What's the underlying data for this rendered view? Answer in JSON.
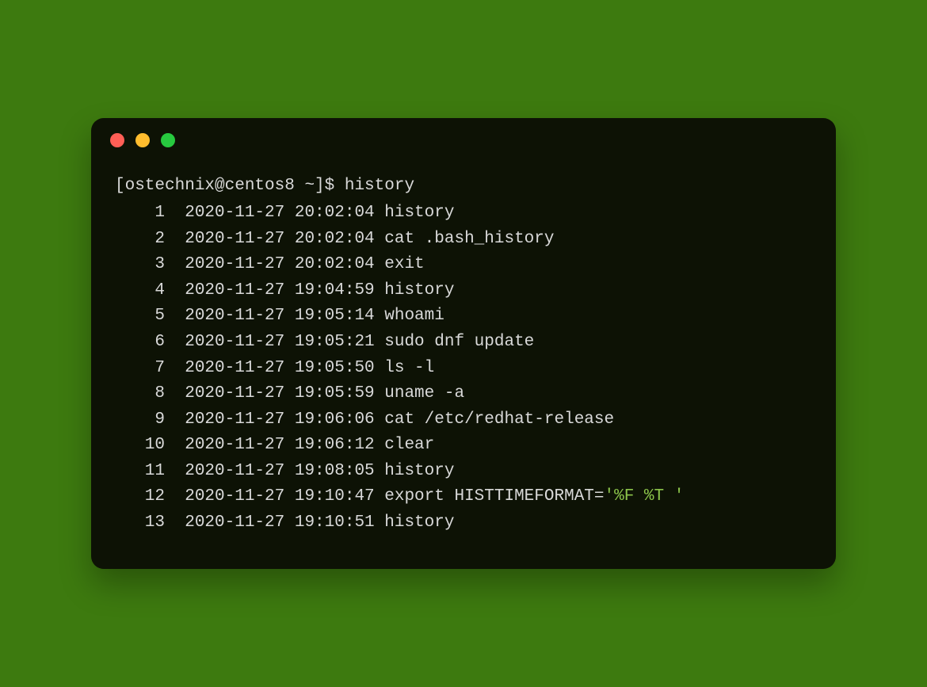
{
  "prompt": {
    "user": "ostechnix",
    "host": "centos8",
    "path": "~",
    "symbol": "$",
    "command": "history"
  },
  "history": [
    {
      "n": 1,
      "ts": "2020-11-27 20:02:04",
      "cmd": "history"
    },
    {
      "n": 2,
      "ts": "2020-11-27 20:02:04",
      "cmd": "cat .bash_history"
    },
    {
      "n": 3,
      "ts": "2020-11-27 20:02:04",
      "cmd": "exit"
    },
    {
      "n": 4,
      "ts": "2020-11-27 19:04:59",
      "cmd": "history"
    },
    {
      "n": 5,
      "ts": "2020-11-27 19:05:14",
      "cmd": "whoami"
    },
    {
      "n": 6,
      "ts": "2020-11-27 19:05:21",
      "cmd": "sudo dnf update"
    },
    {
      "n": 7,
      "ts": "2020-11-27 19:05:50",
      "cmd": "ls -l"
    },
    {
      "n": 8,
      "ts": "2020-11-27 19:05:59",
      "cmd": "uname -a"
    },
    {
      "n": 9,
      "ts": "2020-11-27 19:06:06",
      "cmd": "cat /etc/redhat-release"
    },
    {
      "n": 10,
      "ts": "2020-11-27 19:06:12",
      "cmd": "clear"
    },
    {
      "n": 11,
      "ts": "2020-11-27 19:08:05",
      "cmd": "history"
    },
    {
      "n": 12,
      "ts": "2020-11-27 19:10:47",
      "cmd": "export HISTTIMEFORMAT=",
      "quoted": "'%F %T '"
    },
    {
      "n": 13,
      "ts": "2020-11-27 19:10:51",
      "cmd": "history"
    }
  ],
  "colors": {
    "page_bg": "#3d7a0f",
    "terminal_bg": "#0d1205",
    "text": "#d9d9d9",
    "string": "#8bc34a",
    "traffic_red": "#ff5f56",
    "traffic_yellow": "#ffbd2e",
    "traffic_green": "#27c93f"
  }
}
